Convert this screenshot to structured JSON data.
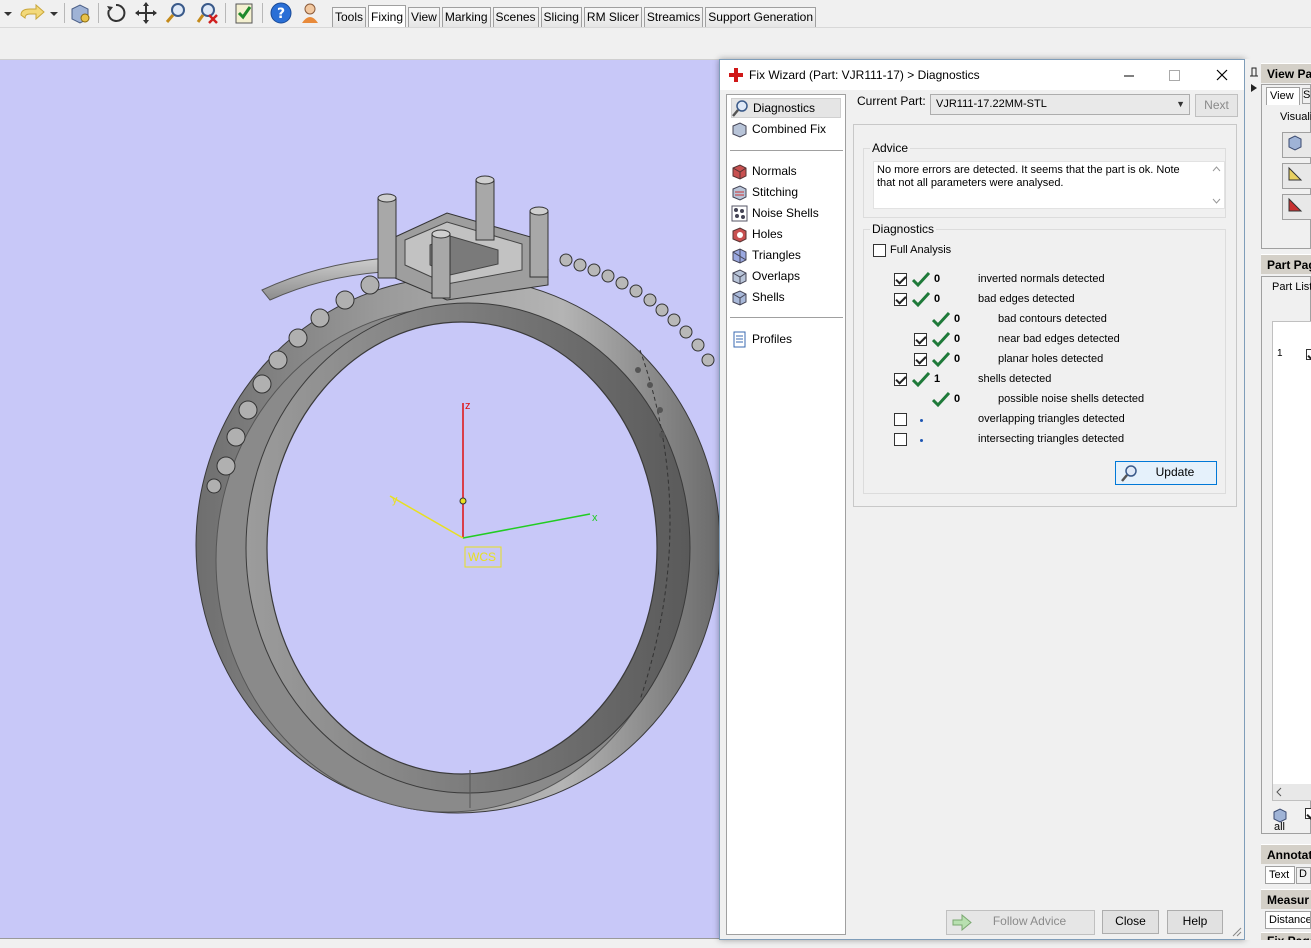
{
  "toolbar": {
    "tabs": [
      "Tools",
      "Fixing",
      "View",
      "Marking",
      "Scenes",
      "Slicing",
      "RM Slicer",
      "Streamics",
      "Support Generation"
    ],
    "active_tab": "Fixing"
  },
  "viewport": {
    "axes": {
      "z": "z",
      "y": "y",
      "x": "x"
    },
    "origin_label": "WCS"
  },
  "dialog": {
    "title": "Fix Wizard (Part: VJR111-17) > Diagnostics",
    "nav": {
      "top_items": [
        "Diagnostics",
        "Combined Fix"
      ],
      "selected": "Diagnostics",
      "fix_items": [
        "Normals",
        "Stitching",
        "Noise Shells",
        "Holes",
        "Triangles",
        "Overlaps",
        "Shells"
      ],
      "bottom_items": [
        "Profiles"
      ]
    },
    "current_part_label": "Current Part:",
    "current_part_value": "VJR111-17.22MM-STL",
    "next_label": "Next",
    "advice": {
      "title": "Advice",
      "text": "No more errors are detected. It seems that the part is ok. Note that not all parameters were analysed."
    },
    "diagnostics": {
      "title": "Diagnostics",
      "full_analysis_label": "Full Analysis",
      "rows": [
        {
          "count": "0",
          "text": "inverted normals detected"
        },
        {
          "count": "0",
          "text": "bad edges detected"
        },
        {
          "count": "0",
          "text": "bad contours detected"
        },
        {
          "count": "0",
          "text": "near bad edges detected"
        },
        {
          "count": "0",
          "text": "planar holes detected"
        },
        {
          "count": "1",
          "text": "shells detected"
        },
        {
          "count": "0",
          "text": "possible noise shells detected"
        },
        {
          "count": "",
          "text": "overlapping triangles detected"
        },
        {
          "count": "",
          "text": "intersecting triangles detected"
        }
      ],
      "update_label": "Update"
    },
    "footer": {
      "follow_advice": "Follow Advice",
      "close": "Close",
      "help": "Help"
    }
  },
  "rightpane": {
    "view_pages": "View Pag",
    "view_tab": "View",
    "view_tab2": "S",
    "visual_label": "Visuali",
    "part_pages": "Part Pag",
    "part_list": "Part List",
    "row_index": "1",
    "all_label": "all",
    "annotations": "Annotat",
    "text_tab": "Text",
    "text_tab2": "D",
    "measure": "Measur",
    "distance": "Distance",
    "fix_pages": "Fix Page"
  },
  "colors": {
    "viewport_bg": "#c8c8f8",
    "check_green": "#1f7a3a",
    "axis_z": "#e01010",
    "axis_x": "#22cc22",
    "axis_y": "#e8e020"
  }
}
